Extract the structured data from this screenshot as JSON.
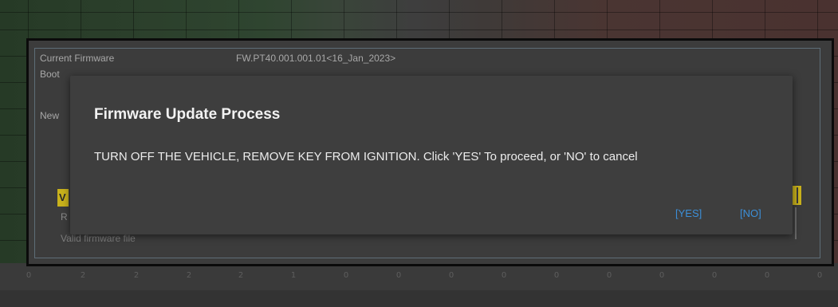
{
  "panel": {
    "current_firmware_label": "Current Firmware",
    "current_firmware_value": "FW.PT40.001.001.01<16_Jan_2023>",
    "bootloader_label_fragment": "Boot",
    "bootloader_value_fragment": "",
    "new_label_fragment": "New",
    "yellow_left_fragment": "V",
    "r_fragment": "R",
    "valid_firmware_text": "Valid firmware file"
  },
  "grid": {
    "bottom_labels": [
      "0",
      "2",
      "2",
      "2",
      "2",
      "1",
      "0",
      "0",
      "0",
      "0",
      "0",
      "0",
      "0",
      "0",
      "0",
      "0"
    ]
  },
  "dialog": {
    "title": "Firmware Update Process",
    "message": "TURN OFF THE VEHICLE, REMOVE KEY FROM IGNITION. Click 'YES' To proceed, or 'NO' to cancel",
    "yes_label": "[YES]",
    "no_label": "[NO]"
  },
  "colors": {
    "accent_link": "#3c8fd8",
    "highlight_yellow": "#c9b21c",
    "dialog_bg": "#3e3e3e"
  }
}
